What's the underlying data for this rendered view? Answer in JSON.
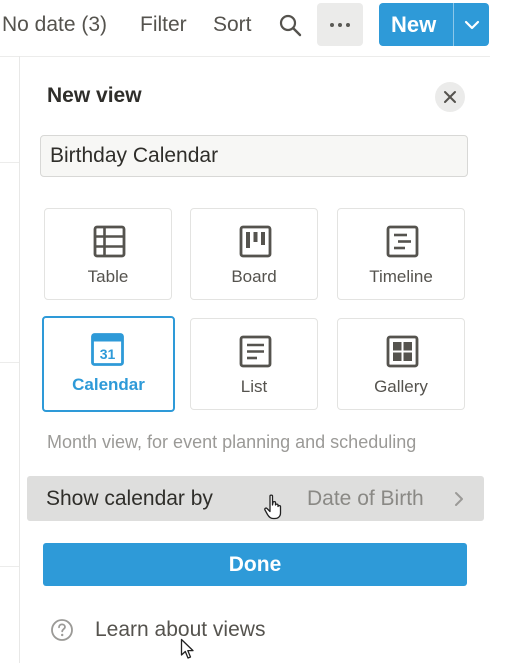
{
  "toolbar": {
    "no_date_label": "No date (3)",
    "filter_label": "Filter",
    "sort_label": "Sort",
    "search_icon": "search-icon",
    "more_icon": "more-horizontal-icon",
    "new_label": "New",
    "new_dropdown_icon": "chevron-down-icon"
  },
  "panel": {
    "title": "New view",
    "close_icon": "close-icon",
    "name_input_value": "Birthday Calendar",
    "view_types": [
      {
        "label": "Table",
        "icon": "table-icon",
        "selected": false
      },
      {
        "label": "Board",
        "icon": "board-icon",
        "selected": false
      },
      {
        "label": "Timeline",
        "icon": "timeline-icon",
        "selected": false
      },
      {
        "label": "Calendar",
        "icon": "calendar-icon",
        "icon_text": "31",
        "selected": true
      },
      {
        "label": "List",
        "icon": "list-icon",
        "selected": false
      },
      {
        "label": "Gallery",
        "icon": "gallery-icon",
        "selected": false
      }
    ],
    "description": "Month view, for event planning and scheduling",
    "show_by": {
      "label": "Show calendar by",
      "value": "Date of Birth",
      "icon": "chevron-right-icon"
    },
    "done_label": "Done",
    "learn_link": {
      "icon": "help-circle-icon",
      "label": "Learn about views"
    }
  },
  "colors": {
    "accent": "#2e9ad8",
    "text": "#37352f",
    "muted": "#9b9a97",
    "hover_row": "#dededd"
  }
}
